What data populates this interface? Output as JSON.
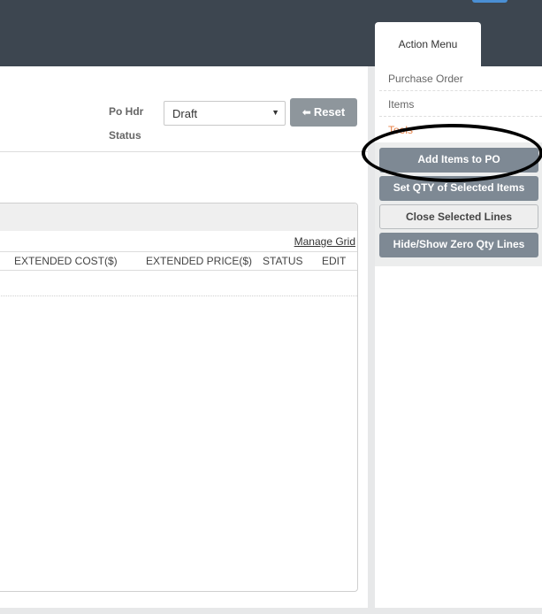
{
  "filters": {
    "po_label": "Po Hdr",
    "status_label": "Status",
    "status_value": "Draft",
    "reset_label": "Reset"
  },
  "grid": {
    "manage_label": "Manage Grid",
    "columns": [
      "EXTENDED COST($)",
      "EXTENDED PRICE($)",
      "STATUS",
      "EDIT"
    ]
  },
  "action_menu": {
    "title": "Action Menu",
    "items": [
      "Purchase Order",
      "Items",
      "Tools"
    ],
    "buttons": [
      "Add Items to PO",
      "Set QTY of Selected Items",
      "Close Selected Lines",
      "Hide/Show Zero Qty Lines"
    ]
  },
  "colors": {
    "topbar": "#3d4650",
    "button_dark": "#7e8994",
    "tools_accent": "#e8834a",
    "annotation": "#000000"
  }
}
